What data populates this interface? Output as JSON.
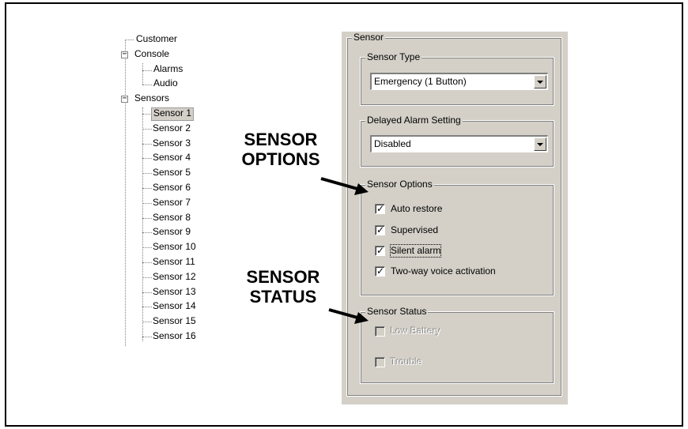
{
  "tree": {
    "nodes": [
      {
        "label": "Customer"
      },
      {
        "label": "Console",
        "expander": "−"
      },
      {
        "label": "Alarms"
      },
      {
        "label": "Audio"
      },
      {
        "label": "Sensors",
        "expander": "−"
      },
      {
        "label": "Sensor 1"
      },
      {
        "label": "Sensor 2"
      },
      {
        "label": "Sensor 3"
      },
      {
        "label": "Sensor 4"
      },
      {
        "label": "Sensor 5"
      },
      {
        "label": "Sensor 6"
      },
      {
        "label": "Sensor 7"
      },
      {
        "label": "Sensor 8"
      },
      {
        "label": "Sensor 9"
      },
      {
        "label": "Sensor 10"
      },
      {
        "label": "Sensor 11"
      },
      {
        "label": "Sensor 12"
      },
      {
        "label": "Sensor 13"
      },
      {
        "label": "Sensor 14"
      },
      {
        "label": "Sensor 15"
      },
      {
        "label": "Sensor 16"
      }
    ],
    "selected": "Sensor 1"
  },
  "panel": {
    "group_title": "Sensor",
    "sensor_type": {
      "title": "Sensor Type",
      "value": "Emergency (1 Button)"
    },
    "delayed_alarm": {
      "title": "Delayed Alarm Setting",
      "value": "Disabled"
    },
    "sensor_options": {
      "title": "Sensor Options",
      "items": [
        {
          "label": "Auto restore",
          "checked": true
        },
        {
          "label": "Supervised",
          "checked": true
        },
        {
          "label": "Silent alarm",
          "checked": true
        },
        {
          "label": "Two-way voice activation",
          "checked": true
        }
      ]
    },
    "sensor_status": {
      "title": "Sensor Status",
      "items": [
        {
          "label": "Low Battery",
          "checked": false,
          "disabled": true
        },
        {
          "label": "Trouble",
          "checked": false,
          "disabled": true
        }
      ]
    }
  },
  "callouts": {
    "options_line1": "SENSOR",
    "options_line2": "OPTIONS",
    "status_line1": "SENSOR",
    "status_line2": "STATUS"
  },
  "colors": {
    "dialog_bg": "#d4d0c8",
    "selection_bg": "#d4d0c8"
  }
}
